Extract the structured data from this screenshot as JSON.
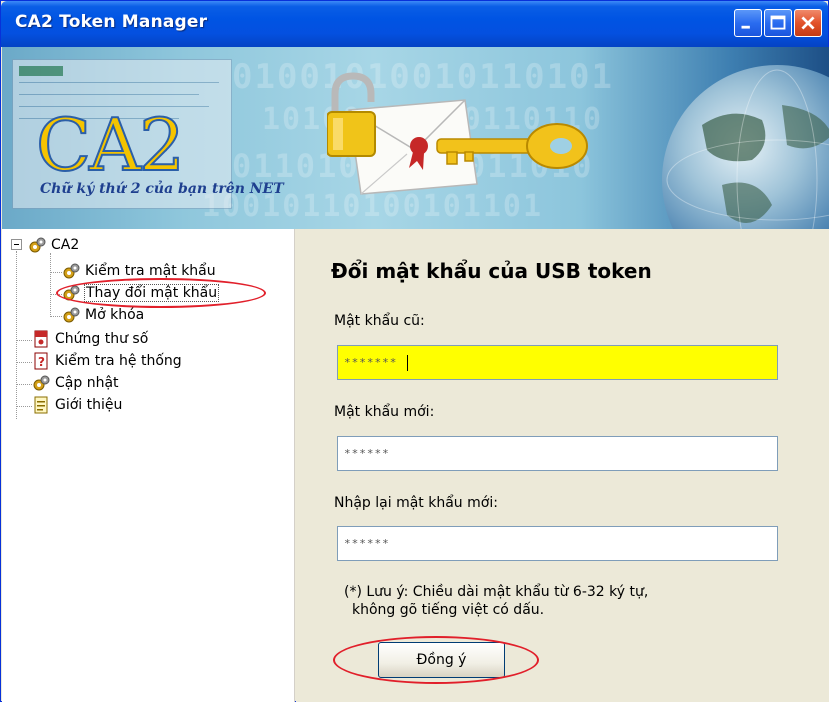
{
  "window": {
    "title": "CA2 Token Manager"
  },
  "banner": {
    "logo_text": "CA2",
    "slogan": "Chữ ký thứ 2 của bạn trên NET",
    "binary_rows": [
      "01001010010110101",
      "10100101100110110",
      "01101001010011010",
      "10010110100101101"
    ]
  },
  "tree": {
    "root": {
      "label": "CA2",
      "icon": "gears-icon"
    },
    "children": [
      {
        "label": "Kiểm tra mật khẩu",
        "icon": "gears-icon"
      },
      {
        "label": "Thay đổi mật khẩu",
        "icon": "gears-icon",
        "selected": true
      },
      {
        "label": "Mở khóa",
        "icon": "gears-icon"
      }
    ],
    "items": [
      {
        "label": "Chứng thư số",
        "icon": "certificate-icon"
      },
      {
        "label": "Kiểm tra hệ thống",
        "icon": "system-check-icon"
      },
      {
        "label": "Cập nhật",
        "icon": "gears-icon"
      },
      {
        "label": "Giới thiệu",
        "icon": "about-icon"
      }
    ]
  },
  "form": {
    "title": "Đổi mật khẩu của USB token",
    "old_password": {
      "label": "Mật khẩu cũ:",
      "value": "*******"
    },
    "new_password": {
      "label": "Mật khẩu mới:",
      "value": "******"
    },
    "confirm_password": {
      "label": "Nhập lại mật khẩu mới:",
      "value": "******"
    },
    "note_line1": "(*) Lưu ý: Chiều dài mật khẩu từ 6-32 ký tự,",
    "note_line2": "không gõ tiếng việt có dấu.",
    "submit_label": "Đồng ý"
  },
  "colors": {
    "titlebar": "#0054e3",
    "active_field": "#ffff00",
    "highlight_ellipse": "#e11f2a",
    "logo_gold": "#f5c400"
  }
}
